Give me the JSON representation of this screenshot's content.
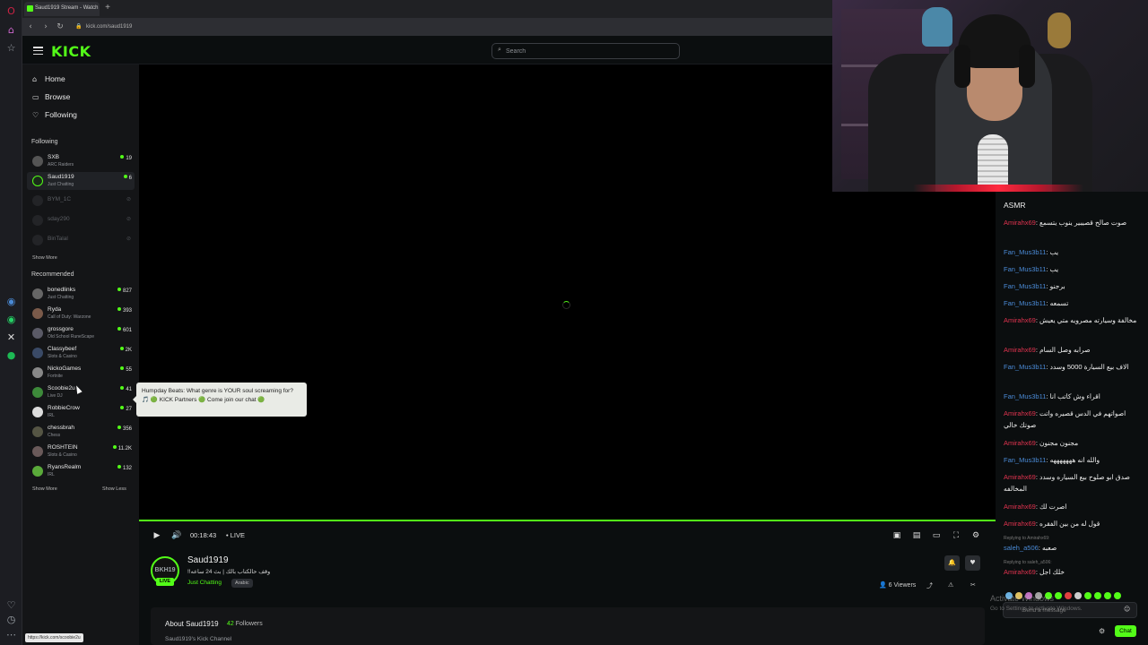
{
  "browser": {
    "tab_title": "Saud1919 Stream - Watch",
    "new_tab_icon": "plus-icon",
    "url": "kick.com/saud1919",
    "status_url": "https://kick.com/scoobie2u"
  },
  "header": {
    "logo": "KICK",
    "search_placeholder": "Search"
  },
  "sidebar": {
    "nav": [
      {
        "label": "Home",
        "icon": "home-icon"
      },
      {
        "label": "Browse",
        "icon": "compass-icon"
      },
      {
        "label": "Following",
        "icon": "heart-icon"
      }
    ],
    "following_title": "Following",
    "following": [
      {
        "name": "SXB",
        "category": "ARC Raiders",
        "viewers": "19",
        "live": true
      },
      {
        "name": "Saud1919",
        "category": "Just Chatting",
        "viewers": "6",
        "live": true,
        "active": true
      },
      {
        "name": "BYM_1C",
        "live": false
      },
      {
        "name": "sday290",
        "live": false
      },
      {
        "name": "BinTalal",
        "live": false
      }
    ],
    "show_more_1": "Show More",
    "recommended_title": "Recommended",
    "recommended": [
      {
        "name": "bonedlinks",
        "category": "Just Chatting",
        "viewers": "827"
      },
      {
        "name": "Ryda",
        "category": "Call of Duty: Warzone",
        "viewers": "393"
      },
      {
        "name": "grossgore",
        "category": "Old School RuneScape",
        "viewers": "601"
      },
      {
        "name": "Classybeef",
        "category": "Slots & Casino",
        "viewers": "2K"
      },
      {
        "name": "NickoGames",
        "category": "Fortnite",
        "viewers": "55"
      },
      {
        "name": "Scoobie2u",
        "category": "Live DJ",
        "viewers": "41"
      },
      {
        "name": "RobbieCrow",
        "category": "IRL",
        "viewers": "27"
      },
      {
        "name": "chessbrah",
        "category": "Chess",
        "viewers": "356"
      },
      {
        "name": "ROSHTEIN",
        "category": "Slots & Casino",
        "viewers": "11.2K"
      },
      {
        "name": "RyansRealm",
        "category": "IRL",
        "viewers": "132"
      }
    ],
    "show_more_2": "Show More",
    "show_less": "Show Less"
  },
  "tooltip": {
    "text": "Humpday Beats: What genre is YOUR soul screaming for? 🎵 🟢 KICK Partners 🟢 Come join our chat 🟢"
  },
  "player": {
    "time": "00:18:43",
    "live_label": "LIVE"
  },
  "stream": {
    "avatar_text": "BKH19",
    "avatar_live": "LIVE",
    "streamer": "Saud1919",
    "title": "وقف حالكتاب بالك | بث 24 ساعه!!",
    "category": "Just Chatting",
    "language": "Arabic",
    "viewers": "6 Viewers"
  },
  "about": {
    "title": "About Saud1919",
    "followers_count": "42",
    "followers_label": "Followers",
    "description": "Saud1919's Kick Channel"
  },
  "chat": {
    "top_text": "ASMR",
    "messages": [
      {
        "user": "Amirahx69",
        "color": "red",
        "text": "صوت صالح قصيبير ينوب يتسمع"
      },
      {
        "user": "Fan_Mus3b11",
        "color": "blue",
        "text": "يب"
      },
      {
        "user": "Fan_Mus3b11",
        "color": "blue",
        "text": "يب"
      },
      {
        "user": "Fan_Mus3b11",
        "color": "blue",
        "text": "برجنو"
      },
      {
        "user": "Fan_Mus3b11",
        "color": "blue",
        "text": "تسمعه"
      },
      {
        "user": "Amirahx69",
        "color": "red",
        "text": "مخالفة وسيارته مصرويه متي يعيش"
      },
      {
        "user": "Amirahx69",
        "color": "red",
        "text": "صرابه وصل السام"
      },
      {
        "user": "Fan_Mus3b11",
        "color": "blue",
        "text": "الاف بيع السيارة 5000 وسدد"
      },
      {
        "user": "Fan_Mus3b11",
        "color": "blue",
        "text": "اقراء وش كاتب انا"
      },
      {
        "user": "Amirahx69",
        "color": "red",
        "text": "اصواتهم في الدس قصيره واتت صوتك خالي"
      },
      {
        "user": "Amirahx69",
        "color": "red",
        "text": "مجنون مجنون"
      },
      {
        "user": "Fan_Mus3b11",
        "color": "blue",
        "text": "والله انه هههههههه"
      },
      {
        "user": "Amirahx69",
        "color": "red",
        "text": "صدق ابو صلوح بيع السياره وسدد المخالفه"
      },
      {
        "user": "Amirahx69",
        "color": "red",
        "text": "اصرت لك"
      },
      {
        "user": "Amirahx69",
        "color": "red",
        "text": "قول له من بين الفقره"
      },
      {
        "reply_to": "Replying to Amirahx69:",
        "user": "saleh_a506",
        "color": "blue",
        "text": "صعبه"
      },
      {
        "reply_to": "Replying to saleh_a506:",
        "user": "Amirahx69",
        "color": "red",
        "text": "خلك اجل"
      }
    ],
    "input_placeholder": "Send a message",
    "send_label": "Chat"
  },
  "watermark": {
    "title": "Activate Windows",
    "subtitle": "Go to Settings to activate Windows."
  },
  "colors": {
    "accent": "#53fc18",
    "user_red": "#e0334f",
    "user_blue": "#4a8ad6",
    "background": "#0b0e0f",
    "sidebar": "#141517"
  }
}
